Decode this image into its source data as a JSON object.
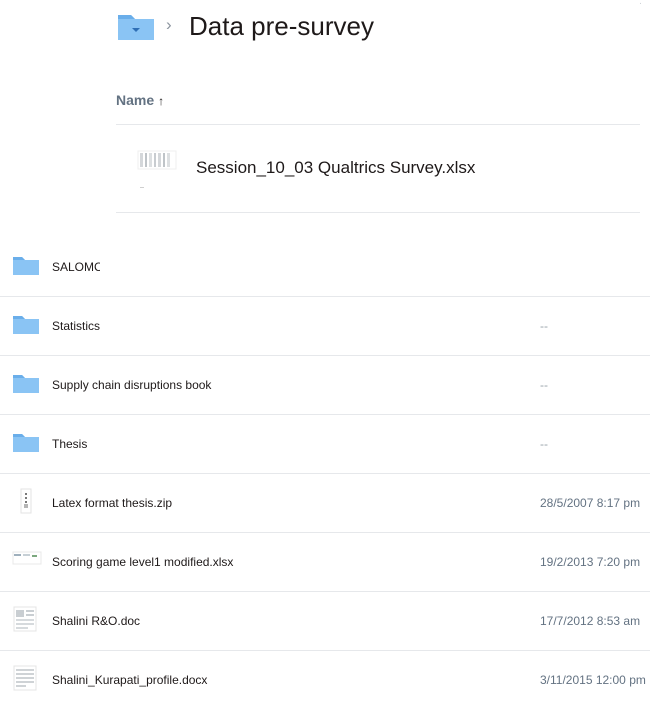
{
  "breadcrumb": {
    "current_folder": "Data pre-survey"
  },
  "overlay": {
    "column_header": "Name",
    "file": {
      "name": "Session_10_03 Qualtrics Survey.xlsx",
      "icon": "excel-file-icon"
    }
  },
  "files": [
    {
      "name": "SALOMC",
      "modified": "",
      "icon": "folder-icon"
    },
    {
      "name": "Statistics",
      "modified": "--",
      "icon": "folder-icon"
    },
    {
      "name": "Supply chain disruptions book",
      "modified": "--",
      "icon": "folder-icon"
    },
    {
      "name": "Thesis",
      "modified": "--",
      "icon": "folder-icon"
    },
    {
      "name": "Latex format thesis.zip",
      "modified": "28/5/2007 8:17 pm",
      "icon": "zip-file-icon"
    },
    {
      "name": "Scoring game level1 modified.xlsx",
      "modified": "19/2/2013 7:20 pm",
      "icon": "spreadsheet-file-icon"
    },
    {
      "name": "Shalini R&O.doc",
      "modified": "17/7/2012 8:53 am",
      "icon": "doc-file-icon"
    },
    {
      "name": "Shalini_Kurapati_profile.docx",
      "modified": "3/11/2015 12:00 pm",
      "icon": "doc-file-icon"
    }
  ],
  "colors": {
    "folder": "#8ac4f4",
    "folder_dark": "#6aaeea",
    "text": "#1e1919",
    "muted": "#637282",
    "divider": "#e6e8eb"
  }
}
